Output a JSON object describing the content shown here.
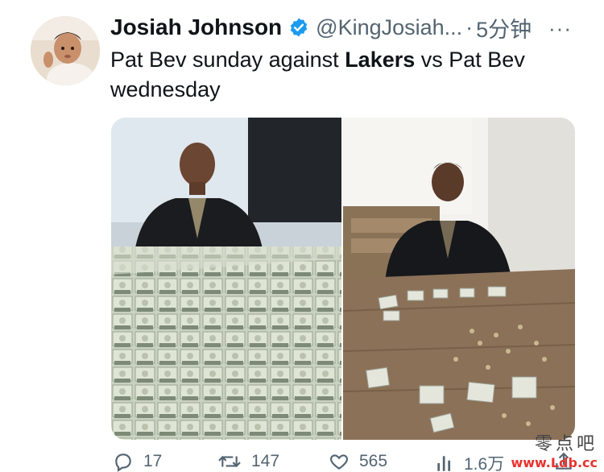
{
  "author": {
    "display_name": "Josiah Johnson",
    "handle": "@KingJosiah...",
    "separator": "·",
    "timestamp": "5分钟",
    "avatar_icon": "baby-photo-avatar",
    "verified_icon": "verified-badge-icon"
  },
  "menu": {
    "more_label": "···"
  },
  "tweet": {
    "text_part1": "Pat Bev sunday against ",
    "text_bold": "Lakers",
    "text_part2": " vs Pat Bev wednesday"
  },
  "media": {
    "left_image": "man-with-stacks-of-cash",
    "right_image": "man-with-few-bills-and-coins"
  },
  "actions": {
    "reply_count": "17",
    "retweet_count": "147",
    "like_count": "565",
    "views_count": "1.6万"
  },
  "watermark": {
    "top": "零点吧",
    "url": "www.Ldb.cc"
  },
  "colors": {
    "text_primary": "#0f1419",
    "text_secondary": "#536471",
    "verified_blue": "#1d9bf0",
    "watermark_red": "#e8332f"
  }
}
